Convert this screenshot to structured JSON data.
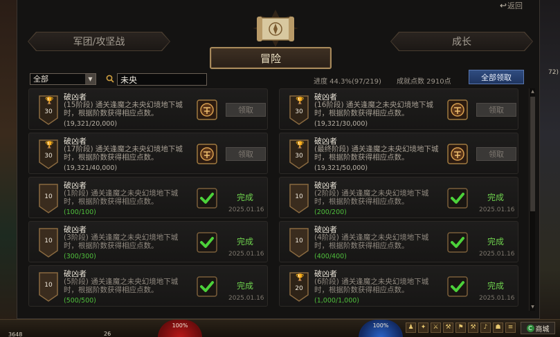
{
  "header": {
    "back_label": "返回",
    "tab_left": "军团/攻坚战",
    "tab_active": "冒险",
    "tab_right": "成长"
  },
  "filter": {
    "category_value": "全部",
    "search_value": "未央",
    "progress": "进度 44.3%(97/219)",
    "points": "成就点数 2910点",
    "claim_all": "全部领取"
  },
  "achievements": [
    {
      "title": "破凶者",
      "desc": "(15阶段) 通关逢魔之未央幻境地下城时，根据阶数获得相应点数。",
      "count": "(19,321/20,000)",
      "points": "30",
      "trophy": true,
      "done": false,
      "claim": "领取"
    },
    {
      "title": "破凶者",
      "desc": "(16阶段) 通关逢魔之未央幻境地下城时，根据阶数获得相应点数。",
      "count": "(19,321/30,000)",
      "points": "30",
      "trophy": true,
      "done": false,
      "claim": "领取"
    },
    {
      "title": "破凶者",
      "desc": "(17阶段) 通关逢魔之未央幻境地下城时，根据阶数获得相应点数。",
      "count": "(19,321/40,000)",
      "points": "30",
      "trophy": true,
      "done": false,
      "claim": "领取"
    },
    {
      "title": "破凶者",
      "desc": "(最终阶段) 通关逢魔之未央幻境地下城时，根据阶数获得相应点数。",
      "count": "(19,321/50,000)",
      "points": "30",
      "trophy": true,
      "done": false,
      "claim": "领取"
    },
    {
      "title": "破凶者",
      "desc": "(1阶段) 通关逢魔之未央幻境地下城时，根据阶数获得相应点数。",
      "count": "(100/100)",
      "points": "10",
      "trophy": false,
      "done": true,
      "status": "完成",
      "date": "2025.01.16"
    },
    {
      "title": "破凶者",
      "desc": "(2阶段) 通关逢魔之未央幻境地下城时，根据阶数获得相应点数。",
      "count": "(200/200)",
      "points": "10",
      "trophy": false,
      "done": true,
      "status": "完成",
      "date": "2025.01.16"
    },
    {
      "title": "破凶者",
      "desc": "(3阶段) 通关逢魔之未央幻境地下城时，根据阶数获得相应点数。",
      "count": "(300/300)",
      "points": "10",
      "trophy": false,
      "done": true,
      "status": "完成",
      "date": "2025.01.16"
    },
    {
      "title": "破凶者",
      "desc": "(4阶段) 通关逢魔之未央幻境地下城时，根据阶数获得相应点数。",
      "count": "(400/400)",
      "points": "10",
      "trophy": false,
      "done": true,
      "status": "完成",
      "date": "2025.01.16"
    },
    {
      "title": "破凶者",
      "desc": "(5阶段) 通关逢魔之未央幻境地下城时，根据阶数获得相应点数。",
      "count": "(500/500)",
      "points": "10",
      "trophy": false,
      "done": true,
      "status": "完成",
      "date": "2025.01.16"
    },
    {
      "title": "破凶者",
      "desc": "(6阶段) 通关逢魔之未央幻境地下城时，根据阶数获得相应点数。",
      "count": "(1,000/1,000)",
      "points": "20",
      "trophy": true,
      "done": true,
      "status": "完成",
      "date": "2025.01.16"
    }
  ],
  "hud": {
    "level": "3648",
    "count_26": "26",
    "hp": "100%",
    "mp": "100%",
    "shop": "商城",
    "side_number": "72)"
  },
  "colors": {
    "done_green": "#6fd24e",
    "claim_all_blue": "#2f4c80",
    "gold_frame": "#a88a5c"
  }
}
